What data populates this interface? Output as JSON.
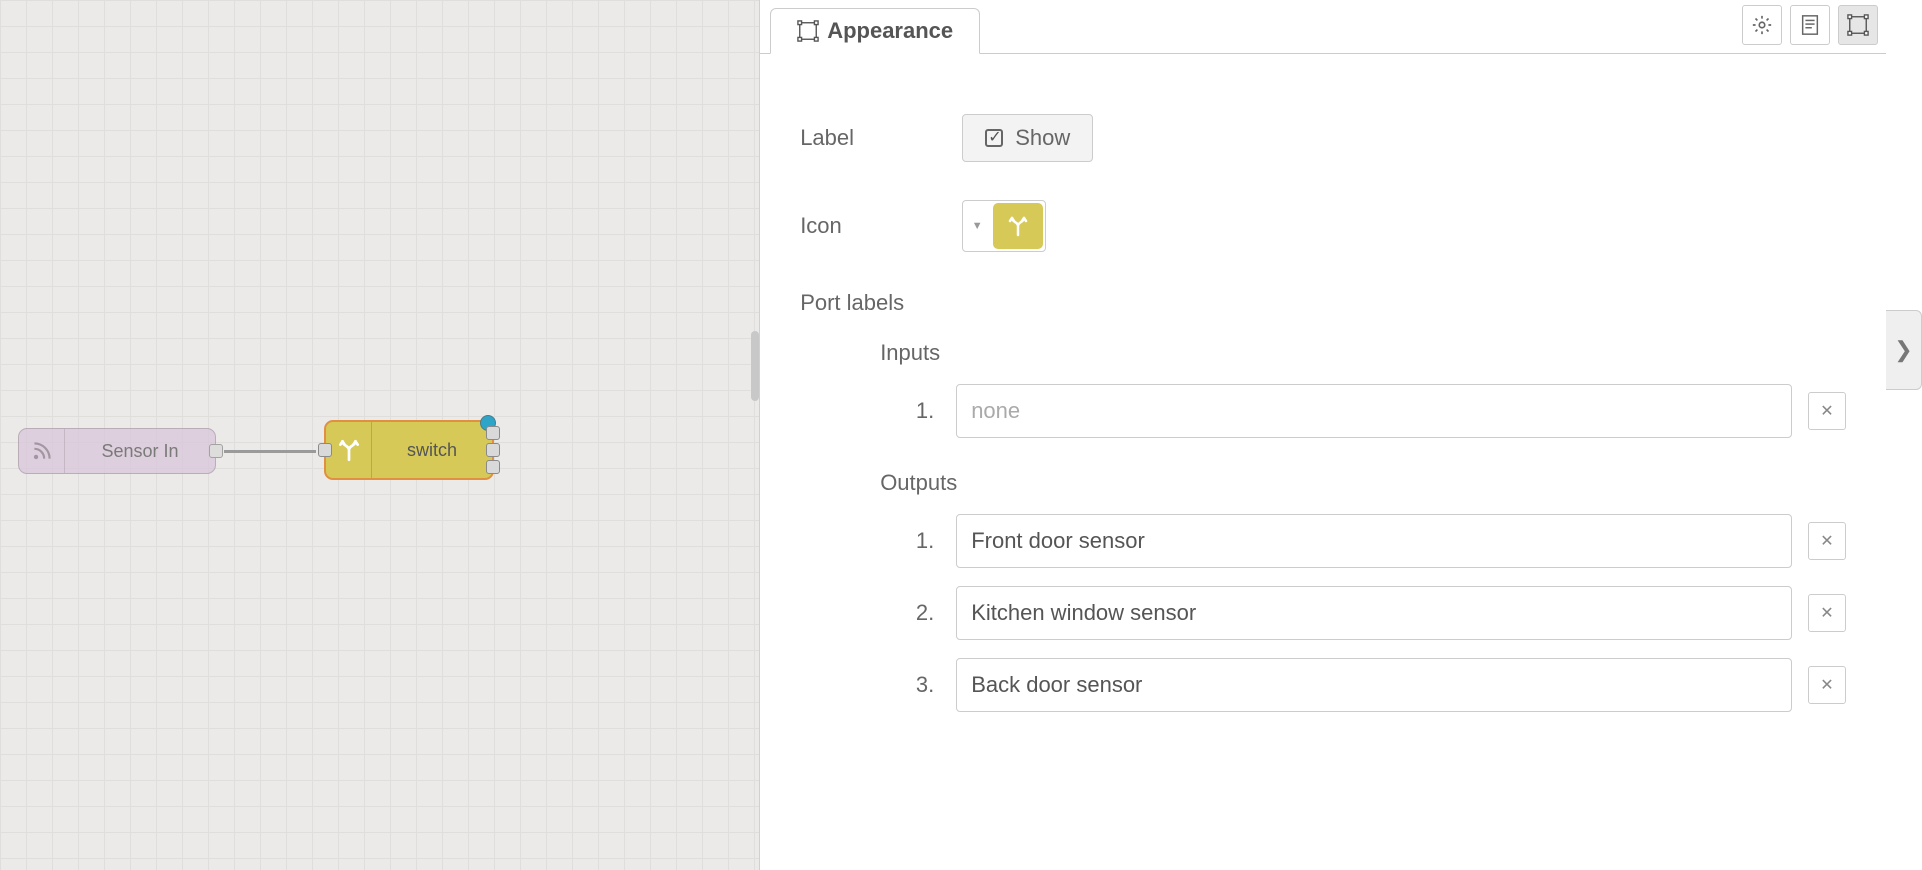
{
  "canvas": {
    "nodes": {
      "sensor": {
        "label": "Sensor In"
      },
      "switch": {
        "label": "switch"
      }
    }
  },
  "panel": {
    "tab_label": "Appearance",
    "fields": {
      "label_field": "Label",
      "show_button": "Show",
      "icon_field": "Icon",
      "port_labels_heading": "Port labels",
      "inputs_heading": "Inputs",
      "outputs_heading": "Outputs"
    },
    "inputs": [
      {
        "num": "1.",
        "value": "",
        "placeholder": "none"
      }
    ],
    "outputs": [
      {
        "num": "1.",
        "value": "Front door sensor"
      },
      {
        "num": "2.",
        "value": "Kitchen window sensor"
      },
      {
        "num": "3.",
        "value": "Back door sensor"
      }
    ]
  }
}
